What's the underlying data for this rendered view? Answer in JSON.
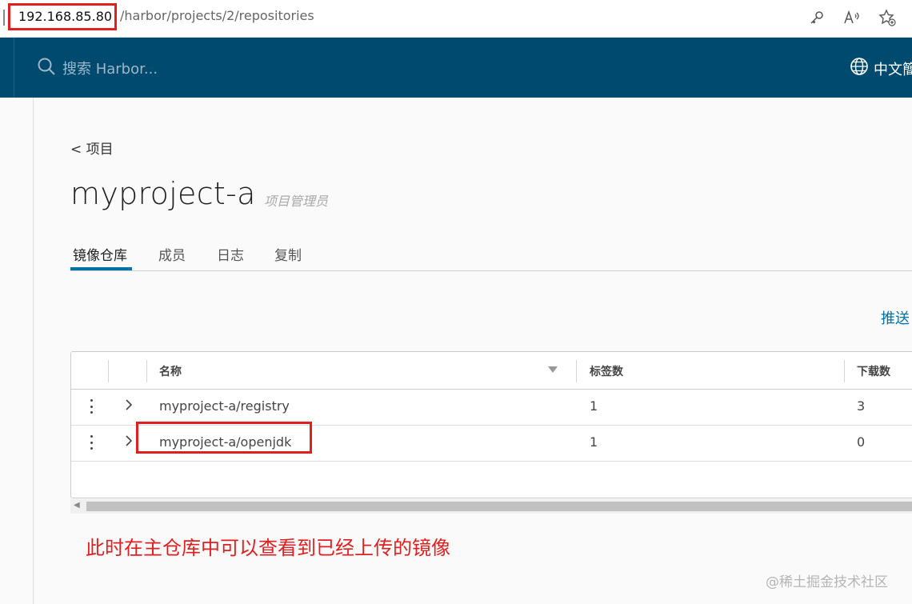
{
  "browser": {
    "url_host": "192.168.85.80",
    "url_path": "/harbor/projects/2/repositories"
  },
  "header": {
    "search_placeholder": "搜索 Harbor...",
    "language": "中文簡"
  },
  "page": {
    "back_link": "< 项目",
    "project_name": "myproject-a",
    "role": "项目管理员",
    "tabs": [
      {
        "label": "镜像仓库",
        "active": true
      },
      {
        "label": "成员",
        "active": false
      },
      {
        "label": "日志",
        "active": false
      },
      {
        "label": "复制",
        "active": false
      }
    ],
    "push_label": "推送"
  },
  "table": {
    "columns": [
      "名称",
      "标签数",
      "下载数"
    ],
    "rows": [
      {
        "name": "myproject-a/registry",
        "tags": "1",
        "pulls": "3"
      },
      {
        "name": "myproject-a/openjdk",
        "tags": "1",
        "pulls": "0"
      }
    ]
  },
  "annotation": "此时在主仓库中可以查看到已经上传的镜像",
  "watermark": "@稀土掘金技术社区",
  "colors": {
    "header": "#004a70",
    "accent": "#0072a3",
    "highlight": "#e02020"
  }
}
